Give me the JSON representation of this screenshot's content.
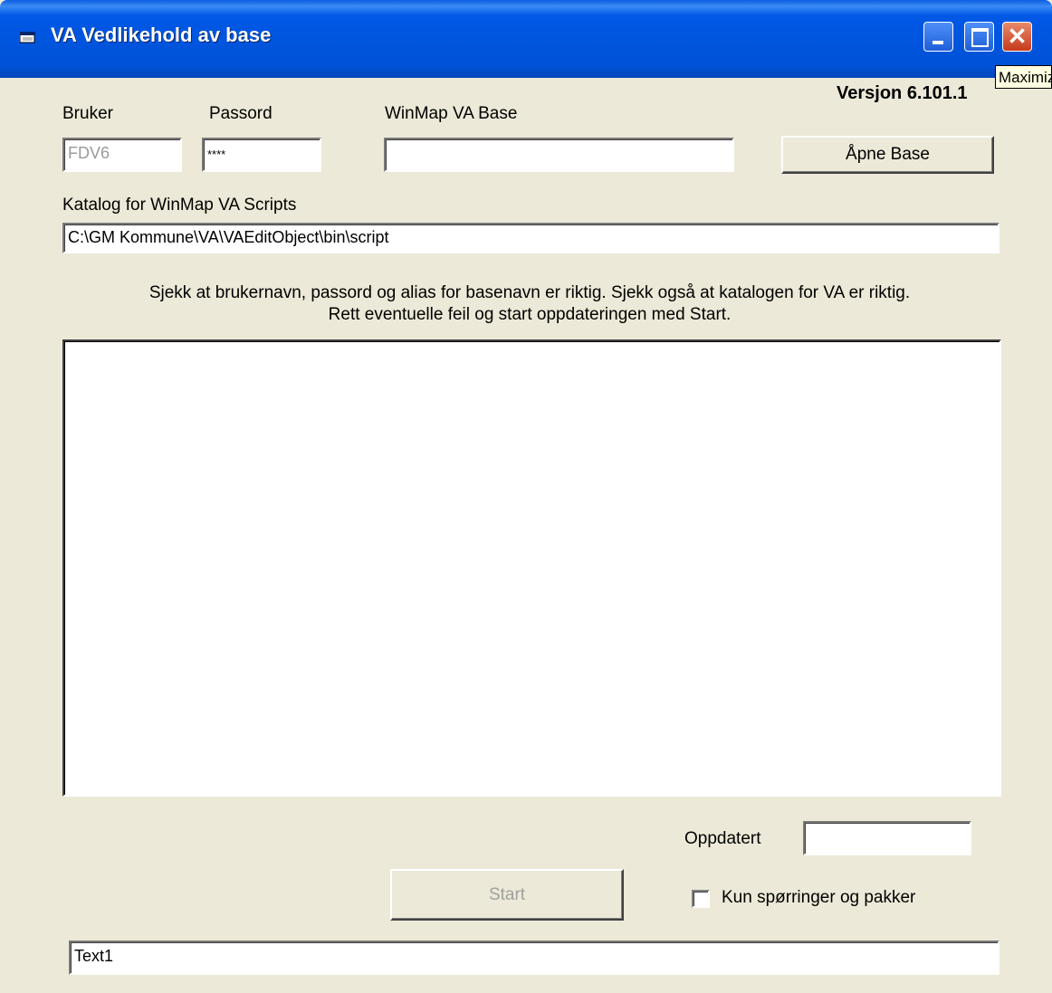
{
  "window": {
    "title": "VA Vedlikehold av base",
    "tooltip": "Maximize"
  },
  "version_label": "Versjon 6.101.1",
  "login": {
    "user_label": "Bruker",
    "user_value": "FDV6",
    "password_label": "Passord",
    "password_value": "****",
    "base_label": "WinMap VA Base",
    "base_value": "",
    "open_button": "Åpne Base"
  },
  "scripts": {
    "label": "Katalog for WinMap VA Scripts",
    "path": "C:\\GM Kommune\\VA\\VAEditObject\\bin\\script"
  },
  "info": {
    "line1": "Sjekk at brukernavn, passord og alias for basenavn er riktig.  Sjekk også at katalogen for VA er riktig.",
    "line2": "Rett eventuelle feil og start oppdateringen med Start."
  },
  "updated": {
    "label": "Oppdatert",
    "value": ""
  },
  "start_button": "Start",
  "only_queries_checkbox": {
    "label": "Kun spørringer og pakker",
    "checked": false
  },
  "status_text": "Text1"
}
